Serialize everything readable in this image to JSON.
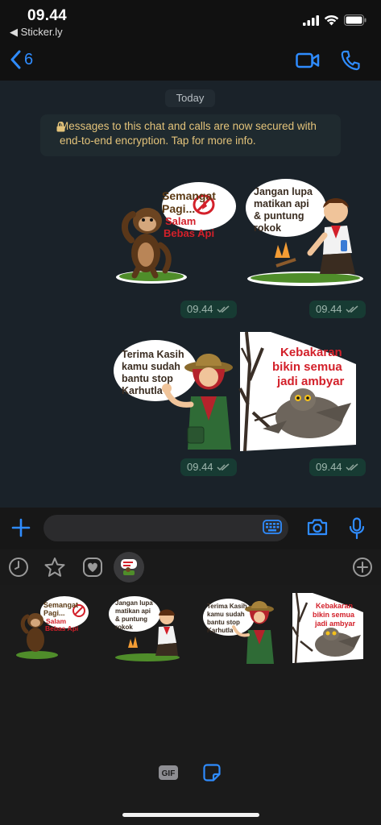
{
  "status_bar": {
    "time": "09.44",
    "back_app": "◀ Sticker.ly"
  },
  "header": {
    "back_count": "6"
  },
  "chat": {
    "date_label": "Today",
    "encryption_notice": "Messages to this chat and calls are now secured with end-to-end encryption. Tap for more info.",
    "messages": [
      {
        "time": "09.44",
        "sticker": "Semangat Pagi... Salam Bebas Api"
      },
      {
        "time": "09.44",
        "sticker": "Jangan lupa matikan api & puntung rokok"
      },
      {
        "time": "09.44",
        "sticker": "Terima Kasih kamu sudah bantu stop Karhutla"
      },
      {
        "time": "09.44",
        "sticker": "Kebakaran bikin semua jadi ambyar"
      }
    ]
  },
  "stickers": {
    "s1": {
      "l1": "Semangat",
      "l2": "Pagi...",
      "l3": "Salam",
      "l4": "Bebas Api"
    },
    "s2": {
      "l1": "Jangan lupa",
      "l2": "matikan api",
      "l3": "& puntung",
      "l4": "rokok"
    },
    "s3": {
      "l1": "Terima Kasih",
      "l2": "kamu sudah",
      "l3": "bantu stop",
      "l4": "Karhutla"
    },
    "s4": {
      "l1": "Kebakaran",
      "l2": "bikin semua",
      "l3": "jadi ambyar"
    }
  },
  "tray": {
    "gif_label": "GIF"
  },
  "colors": {
    "accent": "#2f8cff",
    "chat_bg": "#1a2229",
    "notice_text": "#e3c37a",
    "time_chip_bg": "#173b33",
    "sticker_red": "#d3202a"
  }
}
